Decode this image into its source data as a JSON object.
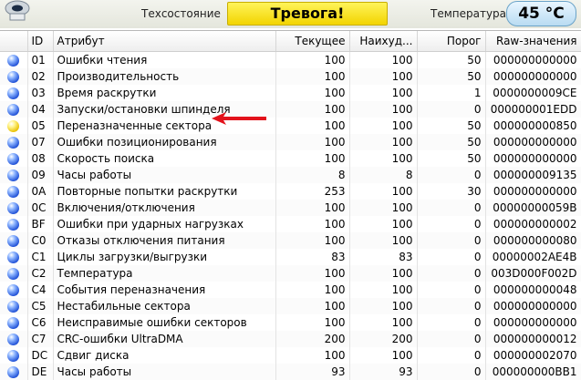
{
  "header": {
    "health_label": "Техсостояние",
    "health_status": "Тревога!",
    "temperature_label": "Температура",
    "temperature_value": "45 °C"
  },
  "table": {
    "columns": [
      "ID",
      "Атрибут",
      "Текущее",
      "Наихуд...",
      "Порог",
      "Raw-значения"
    ],
    "rows": [
      {
        "status": "blue",
        "id": "01",
        "attribute": "Ошибки чтения",
        "current": "100",
        "worst": "100",
        "threshold": "50",
        "raw": "000000000000"
      },
      {
        "status": "blue",
        "id": "02",
        "attribute": "Производительность",
        "current": "100",
        "worst": "100",
        "threshold": "50",
        "raw": "000000000000"
      },
      {
        "status": "blue",
        "id": "03",
        "attribute": "Время раскрутки",
        "current": "100",
        "worst": "100",
        "threshold": "1",
        "raw": "0000000009CE"
      },
      {
        "status": "blue",
        "id": "04",
        "attribute": "Запуски/остановки шпинделя",
        "current": "100",
        "worst": "100",
        "threshold": "0",
        "raw": "000000001EDD"
      },
      {
        "status": "yellow",
        "id": "05",
        "attribute": "Переназначенные сектора",
        "current": "100",
        "worst": "100",
        "threshold": "50",
        "raw": "000000000850"
      },
      {
        "status": "blue",
        "id": "07",
        "attribute": "Ошибки позиционирования",
        "current": "100",
        "worst": "100",
        "threshold": "50",
        "raw": "000000000000"
      },
      {
        "status": "blue",
        "id": "08",
        "attribute": "Скорость поиска",
        "current": "100",
        "worst": "100",
        "threshold": "50",
        "raw": "000000000000"
      },
      {
        "status": "blue",
        "id": "09",
        "attribute": "Часы работы",
        "current": "8",
        "worst": "8",
        "threshold": "0",
        "raw": "000000009135"
      },
      {
        "status": "blue",
        "id": "0A",
        "attribute": "Повторные попытки раскрутки",
        "current": "253",
        "worst": "100",
        "threshold": "30",
        "raw": "000000000000"
      },
      {
        "status": "blue",
        "id": "0C",
        "attribute": "Включения/отключения",
        "current": "100",
        "worst": "100",
        "threshold": "0",
        "raw": "00000000059B"
      },
      {
        "status": "blue",
        "id": "BF",
        "attribute": "Ошибки при ударных нагрузках",
        "current": "100",
        "worst": "100",
        "threshold": "0",
        "raw": "000000000002"
      },
      {
        "status": "blue",
        "id": "C0",
        "attribute": "Отказы отключения питания",
        "current": "100",
        "worst": "100",
        "threshold": "0",
        "raw": "000000000080"
      },
      {
        "status": "blue",
        "id": "C1",
        "attribute": "Циклы загрузки/выгрузки",
        "current": "83",
        "worst": "83",
        "threshold": "0",
        "raw": "00000002AE4B"
      },
      {
        "status": "blue",
        "id": "C2",
        "attribute": "Температура",
        "current": "100",
        "worst": "100",
        "threshold": "0",
        "raw": "003D000F002D"
      },
      {
        "status": "blue",
        "id": "C4",
        "attribute": "События переназначения",
        "current": "100",
        "worst": "100",
        "threshold": "0",
        "raw": "000000000048"
      },
      {
        "status": "blue",
        "id": "C5",
        "attribute": "Нестабильные сектора",
        "current": "100",
        "worst": "100",
        "threshold": "0",
        "raw": "000000000000"
      },
      {
        "status": "blue",
        "id": "C6",
        "attribute": "Неисправимые ошибки секторов",
        "current": "100",
        "worst": "100",
        "threshold": "0",
        "raw": "000000000000"
      },
      {
        "status": "blue",
        "id": "C7",
        "attribute": "CRC-ошибки UltraDMA",
        "current": "200",
        "worst": "200",
        "threshold": "0",
        "raw": "000000000012"
      },
      {
        "status": "blue",
        "id": "DC",
        "attribute": "Сдвиг диска",
        "current": "100",
        "worst": "100",
        "threshold": "0",
        "raw": "000000002070"
      },
      {
        "status": "blue",
        "id": "DE",
        "attribute": "Часы работы",
        "current": "93",
        "worst": "93",
        "threshold": "0",
        "raw": "000000000BB1"
      }
    ]
  },
  "colors": {
    "status_good": "#1e4fd6",
    "status_caution": "#e8c000",
    "alert_bg": "#f2d400",
    "arrow": "#e3121b"
  },
  "annotation": {
    "icon": "red-arrow-icon"
  }
}
